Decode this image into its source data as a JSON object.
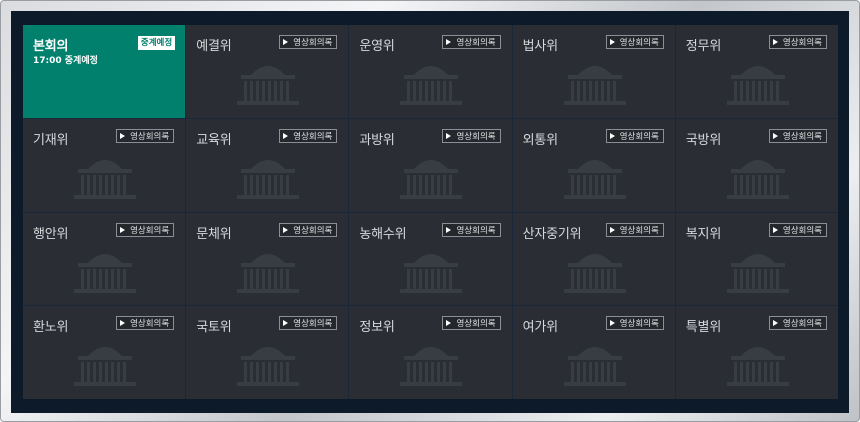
{
  "live_badge": "중계예정",
  "video_button_label": "영상회의록",
  "tiles": [
    {
      "name": "본회의",
      "sub": "17:00 중계예정",
      "live": true
    },
    {
      "name": "예결위",
      "live": false
    },
    {
      "name": "운영위",
      "live": false
    },
    {
      "name": "법사위",
      "live": false
    },
    {
      "name": "정무위",
      "live": false
    },
    {
      "name": "기재위",
      "live": false
    },
    {
      "name": "교육위",
      "live": false
    },
    {
      "name": "과방위",
      "live": false
    },
    {
      "name": "외통위",
      "live": false
    },
    {
      "name": "국방위",
      "live": false
    },
    {
      "name": "행안위",
      "live": false
    },
    {
      "name": "문체위",
      "live": false
    },
    {
      "name": "농해수위",
      "live": false
    },
    {
      "name": "산자중기위",
      "live": false
    },
    {
      "name": "복지위",
      "live": false
    },
    {
      "name": "환노위",
      "live": false
    },
    {
      "name": "국토위",
      "live": false
    },
    {
      "name": "정보위",
      "live": false
    },
    {
      "name": "여가위",
      "live": false
    },
    {
      "name": "특별위",
      "live": false
    }
  ],
  "colors": {
    "live_tile": "#00806d",
    "tile": "#2a2e34",
    "panel": "#0d1a2a"
  },
  "icons": {
    "play": "play-icon",
    "watermark": "national-assembly-building-icon"
  }
}
